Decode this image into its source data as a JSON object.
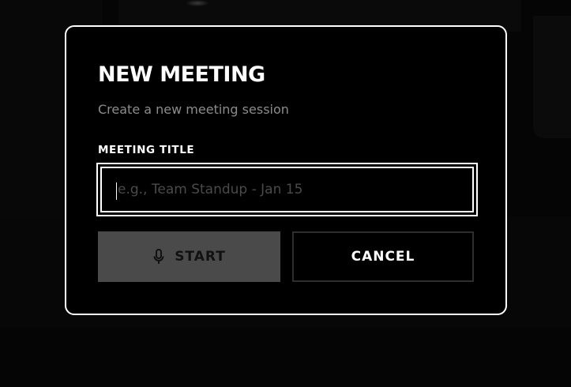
{
  "dialog": {
    "title": "NEW MEETING",
    "subtitle": "Create a new meeting session",
    "field_label": "MEETING TITLE",
    "input": {
      "value": "",
      "placeholder": "e.g., Team Standup - Jan 15"
    },
    "start_button": {
      "label": "START",
      "icon": "microphone-icon",
      "state": "disabled"
    },
    "cancel_button": {
      "label": "CANCEL"
    }
  },
  "colors": {
    "background": "#050505",
    "dialog_background": "#000000",
    "dialog_border": "#ffffff",
    "subtitle_text": "#8c8c8c",
    "placeholder_text": "#4a4a4a",
    "start_button_bg": "#4a4a4a",
    "start_button_text": "#111111",
    "cancel_button_border": "#2e2e2e"
  }
}
